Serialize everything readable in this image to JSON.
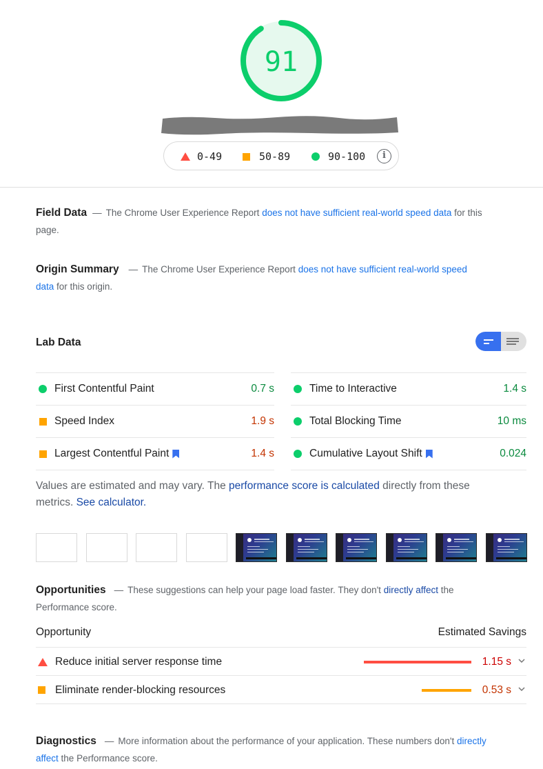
{
  "header": {
    "score": "91",
    "score_ratio": 0.91,
    "legend": {
      "fail_range": "0-49",
      "average_range": "50-89",
      "pass_range": "90-100",
      "info_icon": "info-icon"
    },
    "colors": {
      "pass": "#0cce6b",
      "average": "#ffa400",
      "fail": "#ff4e42",
      "accent": "#3770ef"
    }
  },
  "field_data": {
    "title": "Field Data",
    "text_before": "The Chrome User Experience Report",
    "link": "does not have sufficient real-world speed data",
    "text_after": "for this page."
  },
  "origin_summary": {
    "title": "Origin Summary",
    "text_before": "The Chrome User Experience Report",
    "link": "does not have sufficient real-world speed data",
    "text_after": "for this origin."
  },
  "lab_data": {
    "title": "Lab Data",
    "toggle": {
      "active": "summary-view",
      "inactive": "list-view"
    },
    "metrics": [
      {
        "name": "First Contentful Paint",
        "value": "0.7 s",
        "rating": "pass",
        "bookmark": false
      },
      {
        "name": "Time to Interactive",
        "value": "1.4 s",
        "rating": "pass",
        "bookmark": false
      },
      {
        "name": "Speed Index",
        "value": "1.9 s",
        "rating": "average",
        "bookmark": false
      },
      {
        "name": "Total Blocking Time",
        "value": "10 ms",
        "rating": "pass",
        "bookmark": false
      },
      {
        "name": "Largest Contentful Paint",
        "value": "1.4 s",
        "rating": "average",
        "bookmark": true
      },
      {
        "name": "Cumulative Layout Shift",
        "value": "0.024",
        "rating": "pass",
        "bookmark": true
      }
    ],
    "note_before": "Values are estimated and may vary. The",
    "note_link1": "performance score is calculated",
    "note_middle": "directly from these metrics.",
    "note_link2": "See calculator."
  },
  "filmstrip": {
    "frames": [
      "blank",
      "blank",
      "blank",
      "blank",
      "screenshot",
      "screenshot",
      "screenshot",
      "screenshot",
      "screenshot",
      "screenshot"
    ]
  },
  "opportunities": {
    "title": "Opportunities",
    "text_before": "These suggestions can help your page load faster. They don't",
    "link": "directly affect",
    "text_after": "the Performance score.",
    "col_left": "Opportunity",
    "col_right": "Estimated Savings",
    "items": [
      {
        "name": "Reduce initial server response time",
        "value": "1.15 s",
        "rating": "fail",
        "bar_fraction": 0.85
      },
      {
        "name": "Eliminate render-blocking resources",
        "value": "0.53 s",
        "rating": "average",
        "bar_fraction": 0.39
      }
    ]
  },
  "diagnostics": {
    "title": "Diagnostics",
    "text_before": "More information about the performance of your application. These numbers don't",
    "link": "directly affect",
    "text_after": "the Performance score."
  }
}
